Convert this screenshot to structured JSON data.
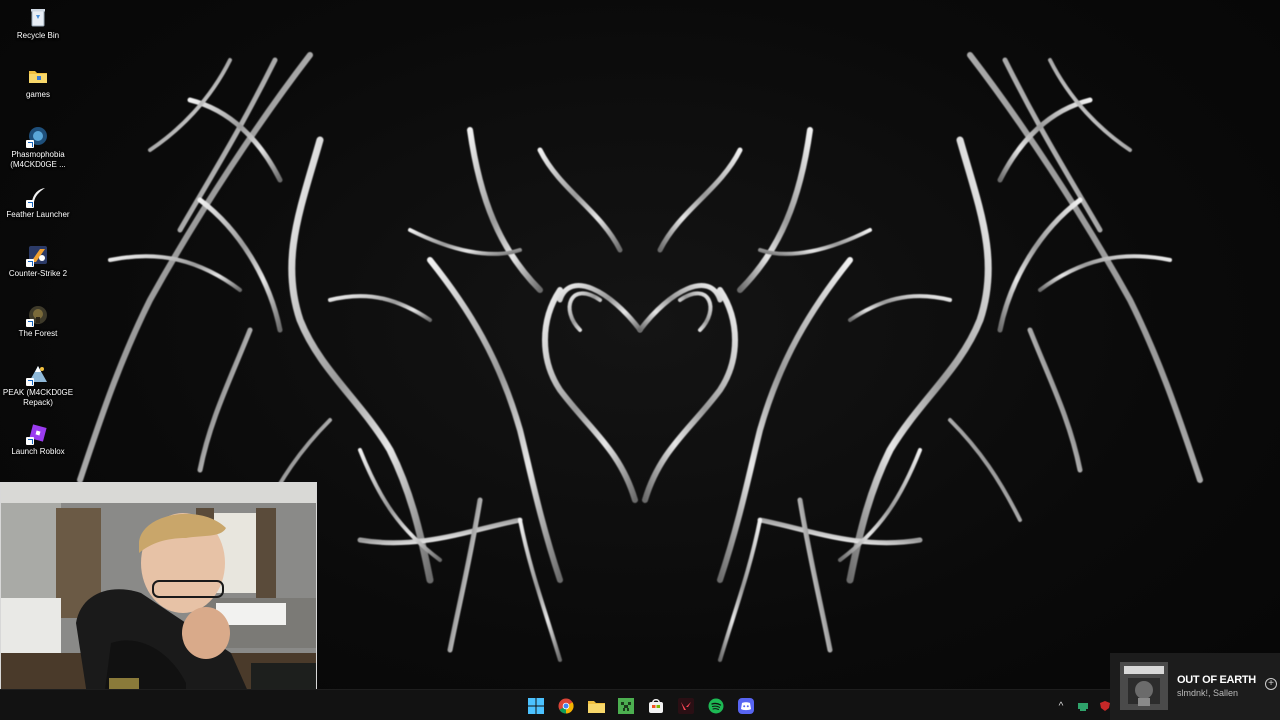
{
  "desktop": {
    "icons": [
      {
        "label": "Recycle Bin",
        "icon": "recycle-bin-icon"
      },
      {
        "label": "games",
        "icon": "folder-icon"
      },
      {
        "label": "Phasmophobia (M4CKD0GE ...",
        "icon": "phasmophobia-icon"
      },
      {
        "label": "Feather Launcher",
        "icon": "feather-icon"
      },
      {
        "label": "Counter-Strike 2",
        "icon": "counter-strike-icon"
      },
      {
        "label": "The Forest",
        "icon": "the-forest-icon"
      },
      {
        "label": "PEAK (M4CKD0GE Repack)",
        "icon": "peak-icon"
      },
      {
        "label": "Launch Roblox",
        "icon": "roblox-icon"
      }
    ]
  },
  "taskbar": {
    "apps": [
      "start-icon",
      "chrome-icon",
      "file-explorer-icon",
      "minecraft-icon",
      "store-icon",
      "valorant-icon",
      "spotify-icon",
      "discord-icon"
    ]
  },
  "tray": {
    "chevron": "^"
  },
  "now_playing": {
    "title": "OUT OF EARTH",
    "artist": "slmdnk!, Sallen",
    "add": "+"
  },
  "colors": {
    "accent": "#1db954",
    "taskbar": "#121212",
    "wallpaper": "#0b0b0b"
  }
}
